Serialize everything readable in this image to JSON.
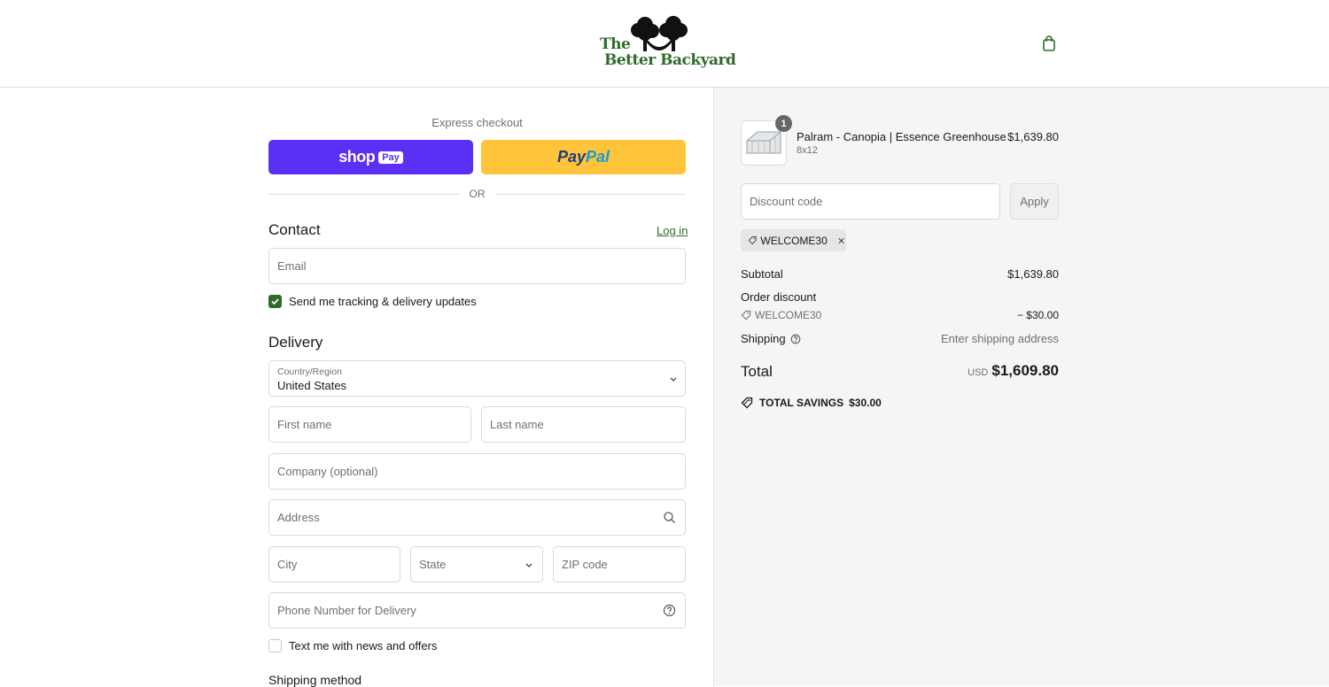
{
  "brand": {
    "logo_line1": "The",
    "logo_line2": "Better Backyard",
    "accent_color": "#2e6b2a",
    "icons": [
      "trees-hammock-logo",
      "shopping-bag-icon"
    ]
  },
  "express": {
    "label": "Express checkout",
    "shoppay_label": "shop",
    "shoppay_badge": "Pay",
    "paypal_part1": "Pay",
    "paypal_part2": "Pal",
    "or_label": "OR"
  },
  "contact": {
    "title": "Contact",
    "login_label": "Log in",
    "email_placeholder": "Email",
    "tracking_label": "Send me tracking & delivery updates",
    "tracking_checked": true
  },
  "delivery": {
    "title": "Delivery",
    "country_label": "Country/Region",
    "country_value": "United States",
    "first_name_placeholder": "First name",
    "last_name_placeholder": "Last name",
    "company_placeholder": "Company (optional)",
    "address_placeholder": "Address",
    "city_placeholder": "City",
    "state_label": "State",
    "zip_placeholder": "ZIP code",
    "phone_placeholder": "Phone Number for Delivery",
    "news_label": "Text me with news and offers",
    "news_checked": false,
    "shipping_method_title": "Shipping method"
  },
  "order": {
    "item": {
      "quantity": "1",
      "title": "Palram - Canopia | Essence Greenhouse",
      "variant": "8x12",
      "price": "$1,639.80"
    },
    "discount_placeholder": "Discount code",
    "apply_label": "Apply",
    "applied_code": "WELCOME30",
    "subtotal_label": "Subtotal",
    "subtotal_value": "$1,639.80",
    "order_discount_label": "Order discount",
    "discount_code": "WELCOME30",
    "discount_value": "− $30.00",
    "shipping_label": "Shipping",
    "shipping_value": "Enter shipping address",
    "total_label": "Total",
    "currency": "USD",
    "total_value": "$1,609.80",
    "savings_label": "TOTAL SAVINGS",
    "savings_value": "$30.00"
  }
}
